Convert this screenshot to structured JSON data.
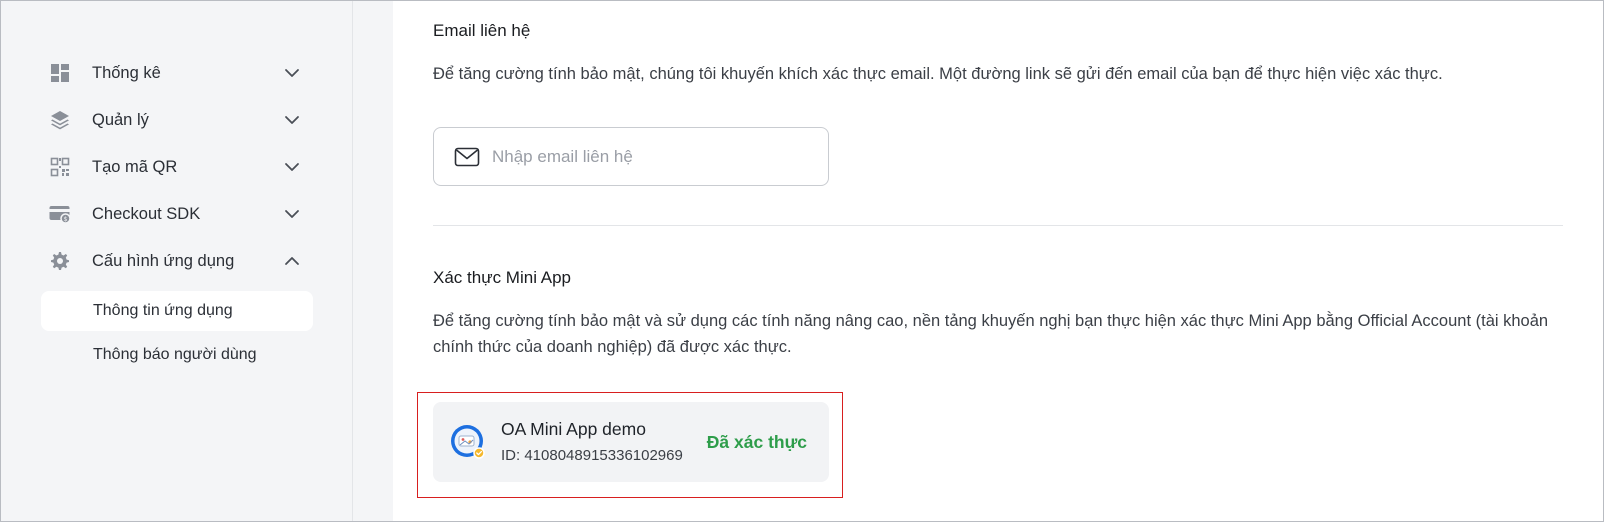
{
  "sidebar": {
    "items": [
      {
        "label": "Thống kê",
        "icon": "dashboard-icon",
        "expanded": false
      },
      {
        "label": "Quản lý",
        "icon": "layers-icon",
        "expanded": false
      },
      {
        "label": "Tạo mã QR",
        "icon": "qr-code-icon",
        "expanded": false
      },
      {
        "label": "Checkout SDK",
        "icon": "payment-card-icon",
        "expanded": false
      },
      {
        "label": "Cấu hình ứng dụng",
        "icon": "gear-icon",
        "expanded": true
      }
    ],
    "sub_items": [
      {
        "label": "Thông tin ứng dụng",
        "active": true
      },
      {
        "label": "Thông báo người dùng",
        "active": false
      }
    ]
  },
  "email_section": {
    "title": "Email liên hệ",
    "description": "Để tăng cường tính bảo mật, chúng tôi khuyến khích xác thực email. Một đường link sẽ gửi đến email của bạn để thực hiện việc xác thực.",
    "input_value": "",
    "input_placeholder": "Nhập email liên hệ"
  },
  "mini_app_section": {
    "title": "Xác thực Mini App",
    "description": "Để tăng cường tính bảo mật và sử dụng các tính năng nâng cao, nền tảng khuyến nghị bạn thực hiện xác thực Mini App bằng Official Account (tài khoản chính thức của doanh nghiệp) đã được xác thực.",
    "oa": {
      "name": "OA Mini App demo",
      "id": "ID: 4108048915336102969",
      "status": "Đã xác thực"
    }
  },
  "colors": {
    "sidebar_bg": "#f4f5f7",
    "verified_green": "#2e9d4a",
    "highlight_red": "#d81f1f",
    "card_bg": "#f2f3f5"
  }
}
